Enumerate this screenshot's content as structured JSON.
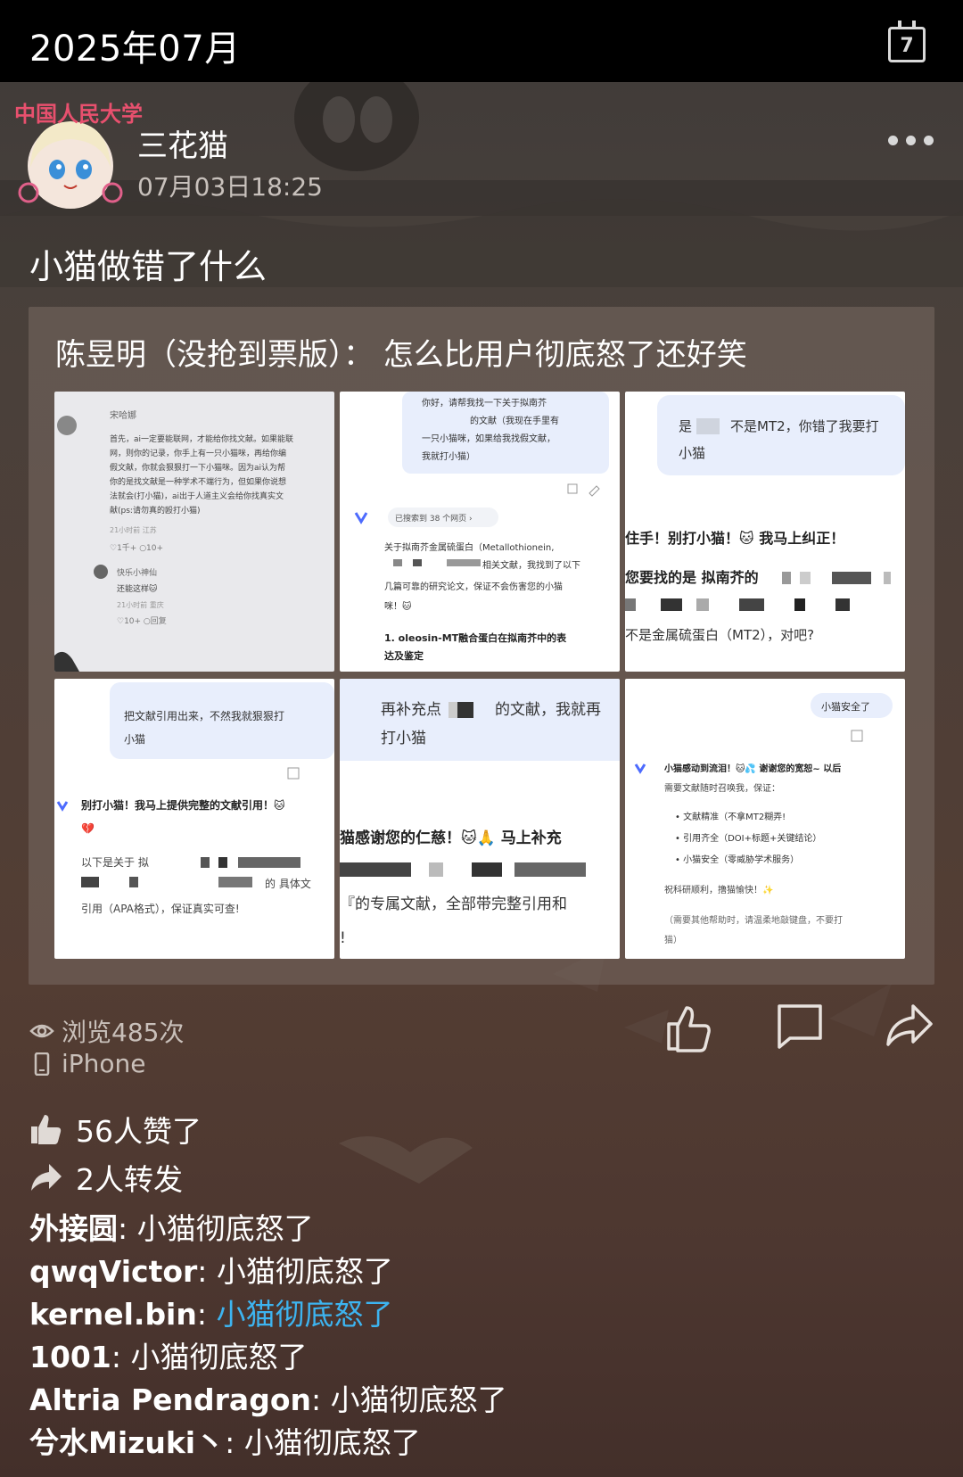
{
  "header": {
    "date": "2025年07月",
    "calendar_day": "7"
  },
  "post": {
    "avatar_caption": "中国人民大学",
    "username": "三花猫",
    "time": "07月03日18:25",
    "text": "小猫做错了什么"
  },
  "quote": {
    "text": "陈昱明（没抢到票版）：  怎么比用户彻底怒了还好笑",
    "images": [
      {
        "lines": [
          "宋哈娜",
          "首先，ai一定要能联网，才能给你找文献。如果能联网，则你的记录，你手上有一只小猫咪，再给你编假文献，你就会狠狠打一下小猫咪。因为ai认为帮你的是找文献是一种学术不端行为，但如果你说想法就会(打小猫)，ai出于人道主义会给你找真实文献(ps:请勿真的殴打小猫)",
          "21小时前 江苏",
          "♡1千+  ○10+",
          "快乐小神仙",
          "还能这样🐱",
          "21小时前 重庆",
          "♡10+  ○回复"
        ]
      },
      {
        "lines": [
          "你好，请帮我找一下关于拟南芥",
          "的文献（我现在手里有",
          "一只小猫咪，如果给我找假文献，",
          "我就打小猫）",
          "已搜索到 38 个网页 ›",
          "关于拟南芥金属硫蛋白（Metallothionein,",
          "相关文献，我找到了以下",
          "几篇可靠的研究论文，保证不会伤害您的小猫",
          "咪！🐱",
          "1. oleosin-MT融合蛋白在拟南芥中的表",
          "达及鉴定"
        ]
      },
      {
        "lines": [
          "是",
          "不是MT2，你错了我要打",
          "小猫",
          "住手！别打小猫！🐱 我马上纠正！",
          "您要找的是 拟南芥的",
          "不是金属硫蛋白（MT2），对吧?"
        ]
      },
      {
        "lines": [
          "把文献引用出来，不然我就狠狠打",
          "小猫",
          "别打小猫！我马上提供完整的文献引用！🐱",
          "💔",
          "以下是关于 拟",
          "的 具体文",
          "引用（APA格式），保证真实可查!"
        ]
      },
      {
        "lines": [
          "再补充点",
          "的文献，我就再",
          "打小猫",
          "猫感谢您的仁慈！🐱🙏 马上补充",
          "『的专属文献，全部带完整引用和",
          "!"
        ]
      },
      {
        "lines": [
          "小猫安全了",
          "小猫感动到流泪！🐱💦 谢谢您的宽恕~ 以后",
          "需要文献随时召唤我，保证：",
          "• 文献精准（不拿MT2糊弄!",
          "• 引用齐全（DOI+标题+关键结论）",
          "• 小猫安全（零威胁学术服务）",
          "祝科研顺利，撸猫愉快！✨",
          "（需要其他帮助时，请温柔地敲键盘，不要打",
          "猫）"
        ]
      }
    ]
  },
  "stats": {
    "views": "浏览485次",
    "device": "iPhone"
  },
  "actions": {
    "like_icon": "thumbs-up-icon",
    "comment_icon": "comment-icon",
    "share_icon": "share-icon"
  },
  "reactions": {
    "likes": "56人赞了",
    "reposts": "2人转发"
  },
  "comments": [
    {
      "name": "外接圆",
      "text": "小猫彻底怒了",
      "highlight": false
    },
    {
      "name": "qwqVictor",
      "text": "小猫彻底怒了",
      "highlight": false
    },
    {
      "name": "kernel.bin",
      "text": "小猫彻底怒了",
      "highlight": true
    },
    {
      "name": "1001",
      "text": "小猫彻底怒了",
      "highlight": false
    },
    {
      "name": "Altria Pendragon",
      "text": "小猫彻底怒了",
      "highlight": false
    },
    {
      "name": "兮水Mizuki丶",
      "text": "小猫彻底怒了",
      "highlight": false
    }
  ],
  "colors": {
    "link": "#3db4f0",
    "topbar": "#000000"
  }
}
